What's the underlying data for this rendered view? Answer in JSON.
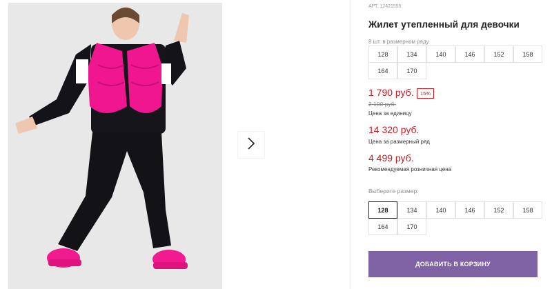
{
  "gallery": {
    "photo_alt": "Жилет утепленный для девочки",
    "next_icon": "chevron-right-icon"
  },
  "product": {
    "sku": "АРТ. 12421555",
    "title": "Жилет утепленный для девочки",
    "pack_label": "8 шт. в размерном ряду",
    "pack_sizes": [
      "128",
      "134",
      "140",
      "146",
      "152",
      "158",
      "164",
      "170"
    ]
  },
  "pricing": {
    "price": "1 790 руб.",
    "discount": "15%",
    "old_price": "2 100 руб.",
    "price_caption": "Цена за единицу",
    "pack_price": "14 320 руб.",
    "pack_caption": "Цена за размерный ряд",
    "rrp_price": "4 499 руб.",
    "rrp_caption": "Рекомендуемая розничная цена",
    "accent_color": "#d0181f"
  },
  "size_select": {
    "label": "Выберите размер:",
    "options": [
      "128",
      "134",
      "140",
      "146",
      "152",
      "158",
      "164",
      "170"
    ],
    "selected": "128"
  },
  "cart": {
    "button_label": "ДОБАВИТЬ В КОРЗИНУ",
    "button_color": "#7e62a4"
  }
}
